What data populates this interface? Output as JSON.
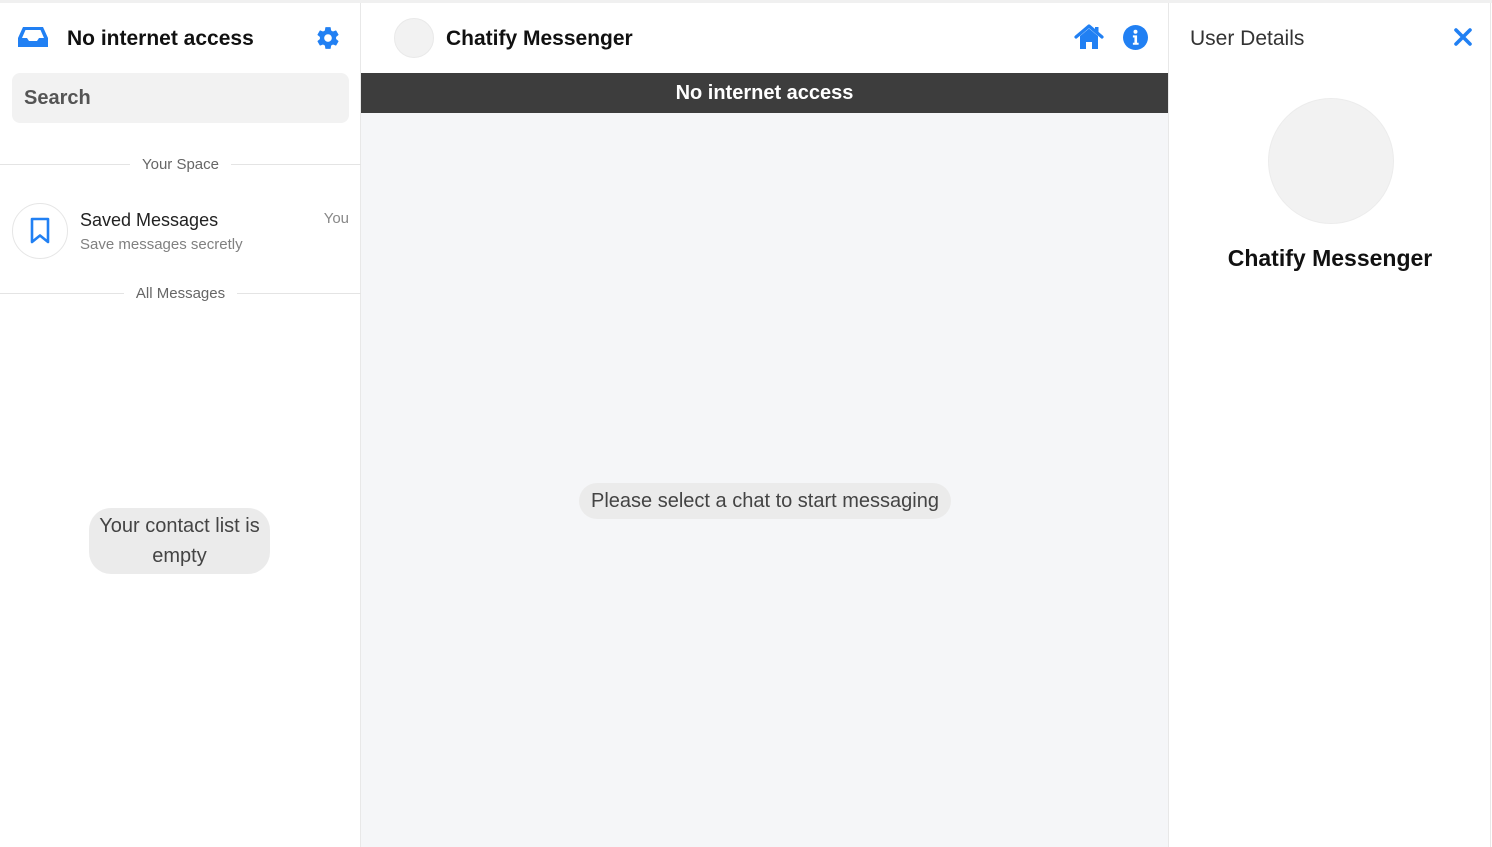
{
  "colors": {
    "accent": "#2180f3",
    "banner_bg": "#3d3d3d",
    "chat_bg": "#f5f6f8"
  },
  "sidebar": {
    "status_title": "No internet access",
    "icons": {
      "logo": "inbox-icon",
      "settings": "gear-icon"
    },
    "search": {
      "placeholder": "Search",
      "value": ""
    },
    "section_your_space": "Your Space",
    "saved": {
      "name": "Saved Messages",
      "subtitle": "Save messages secretly",
      "meta": "You",
      "icon": "bookmark-icon"
    },
    "section_all_messages": "All Messages",
    "empty_state": "Your contact list is empty"
  },
  "chat": {
    "title": "Chatify Messenger",
    "icons": {
      "home": "home-icon",
      "info": "info-icon"
    },
    "offline_banner": "No internet access",
    "placeholder": "Please select a chat to start messaging"
  },
  "details": {
    "title": "User Details",
    "close_icon": "close-icon",
    "name": "Chatify Messenger"
  }
}
